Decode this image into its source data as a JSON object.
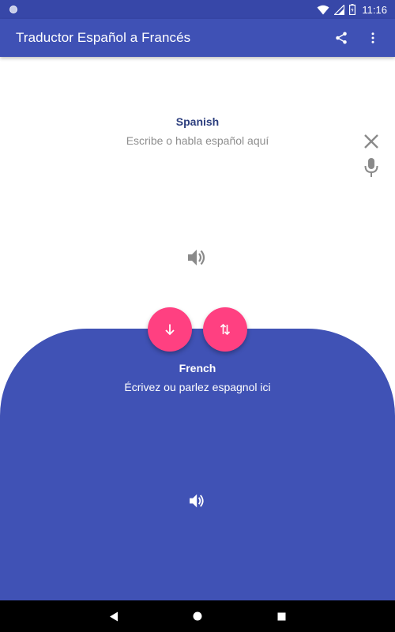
{
  "status_bar": {
    "time": "11:16"
  },
  "app_bar": {
    "title": "Traductor Español a Francés",
    "share_icon": "share-icon",
    "menu_icon": "more-vert-icon"
  },
  "source": {
    "language": "Spanish",
    "placeholder": "Escribe o habla español aquí",
    "value": ""
  },
  "target": {
    "language": "French",
    "text": "Écrivez ou parlez espagnol ici"
  },
  "colors": {
    "primary": "#3f51b5",
    "primary_dark": "#3747a8",
    "accent": "#ff4081",
    "source_label": "#2c3e7e",
    "placeholder": "#8e8e8e"
  }
}
